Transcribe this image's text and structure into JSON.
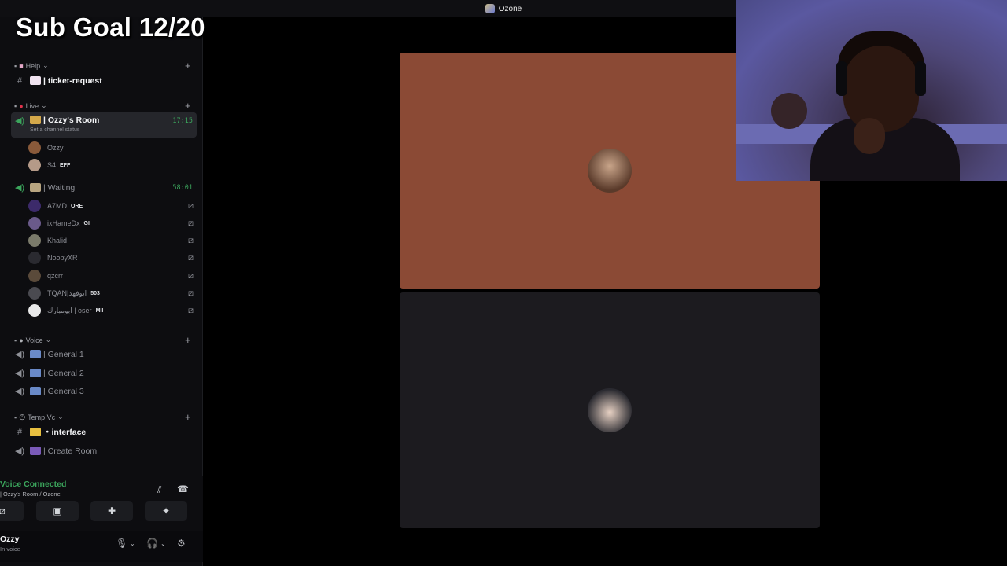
{
  "overlay": {
    "sub_goal": "Sub Goal 12/20"
  },
  "window": {
    "title": "Ozone"
  },
  "categories": {
    "help": "Help",
    "live": "Live",
    "voice": "Voice",
    "temp_vc": "Temp Vc"
  },
  "channels": {
    "ticket_request": "| ticket-request",
    "ozzys_room": "| Ozzy's Room",
    "ozzys_room_time": "17:15",
    "ozzys_room_status": "Set a channel status",
    "waiting": "| Waiting",
    "waiting_time": "58:01",
    "general1": "| General 1",
    "general2": "| General 2",
    "general3": "| General 3",
    "interface": "・interface",
    "create_room": "| Create Room"
  },
  "room_members": [
    {
      "name": "Ozzy",
      "tag": ""
    },
    {
      "name": "S4",
      "tag": "EFF"
    }
  ],
  "waiting_members": [
    {
      "name": "A7MD",
      "tag": "ORE"
    },
    {
      "name": "ixHameDx",
      "tag": "GI"
    },
    {
      "name": "Khalid",
      "tag": ""
    },
    {
      "name": "NoobyXR",
      "tag": ""
    },
    {
      "name": "qzcrr",
      "tag": ""
    },
    {
      "name": "TQAN|ابوفهد",
      "tag": "503"
    },
    {
      "name": "ابومبارك | oser",
      "tag": "MII"
    }
  ],
  "voice_status": {
    "title": "Voice Connected",
    "subtitle": "| Ozzy's Room / Ozone"
  },
  "user": {
    "name": "Ozzy",
    "status": "In voice"
  },
  "colors": {
    "tile_top": "#8b4a35",
    "tile_bottom": "#1c1b1f",
    "connected": "#3ba55c"
  }
}
